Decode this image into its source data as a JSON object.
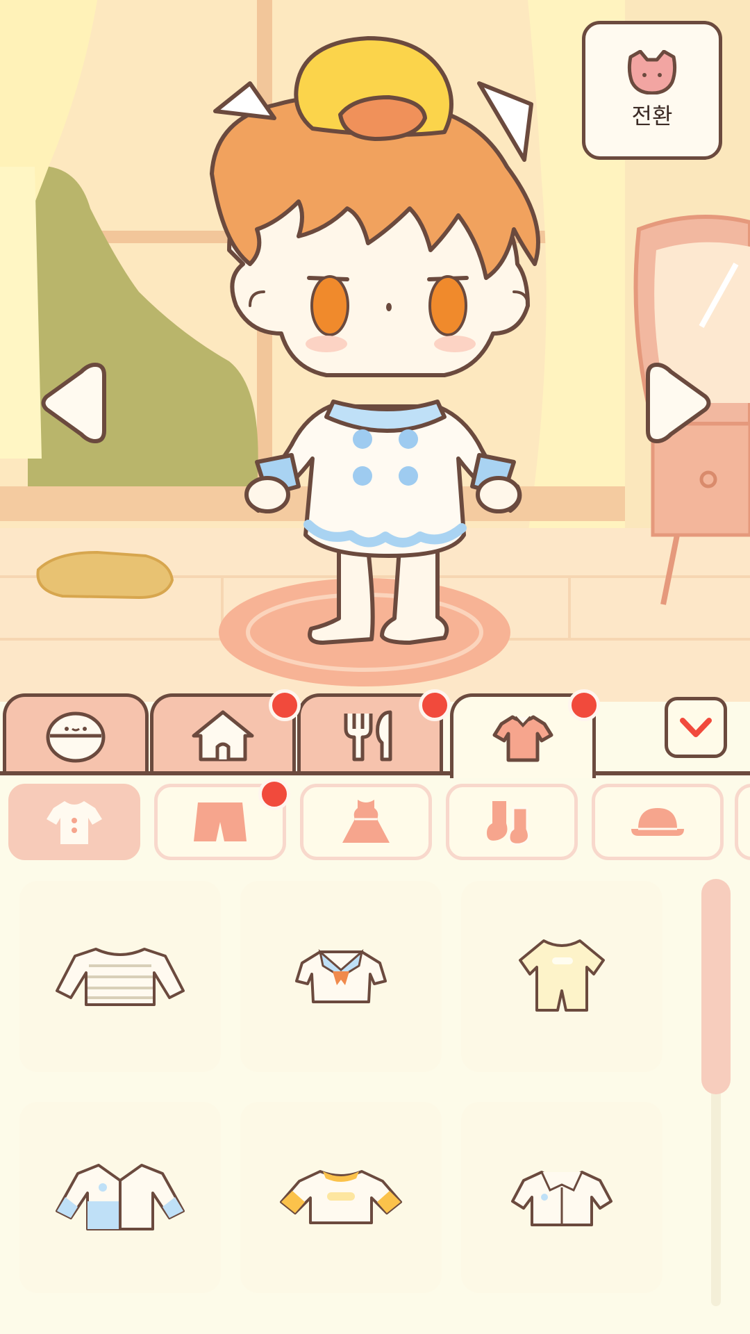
{
  "top_right": {
    "switch_label": "전환",
    "icon": "cat-face-icon"
  },
  "nav": {
    "left_icon": "arrow-left-icon",
    "right_icon": "arrow-right-icon"
  },
  "main_tabs": [
    {
      "icon": "face-icon",
      "active": false,
      "badge": false
    },
    {
      "icon": "house-icon",
      "active": false,
      "badge": true
    },
    {
      "icon": "food-icon",
      "active": false,
      "badge": true
    },
    {
      "icon": "shirt-icon",
      "active": true,
      "badge": true
    }
  ],
  "collapse_icon": "chevron-down-icon",
  "sub_categories": [
    {
      "icon": "top-icon",
      "active": true,
      "badge": false
    },
    {
      "icon": "shorts-icon",
      "active": false,
      "badge": true
    },
    {
      "icon": "dress-icon",
      "active": false,
      "badge": false
    },
    {
      "icon": "socks-icon",
      "active": false,
      "badge": false
    },
    {
      "icon": "hat-icon",
      "active": false,
      "badge": false
    }
  ],
  "items": [
    {
      "icon": "striped-sweater-icon"
    },
    {
      "icon": "sailor-top-icon"
    },
    {
      "icon": "yellow-romper-icon"
    },
    {
      "icon": "blue-jacket-icon"
    },
    {
      "icon": "yellow-tshirt-icon"
    },
    {
      "icon": "white-shirt-icon"
    }
  ],
  "colors": {
    "accent": "#f14a3c",
    "outline": "#6b4a3e",
    "tab": "#f6c3ad",
    "panel": "#fdfbe9"
  }
}
